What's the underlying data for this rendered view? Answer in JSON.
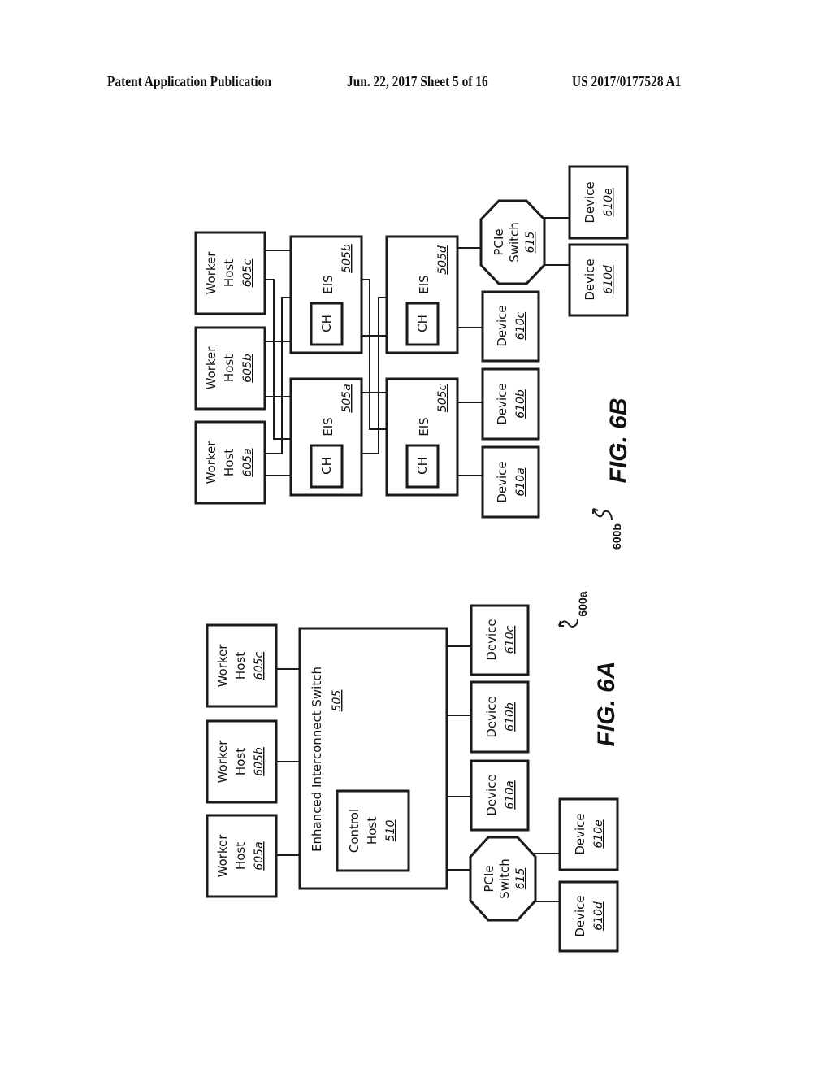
{
  "header": {
    "left": "Patent Application Publication",
    "center": "Jun. 22, 2017  Sheet 5 of 16",
    "right": "US 2017/0177528 A1"
  },
  "fig6b": {
    "caption": "FIG. 6B",
    "ref": "600b",
    "worker_hosts": [
      {
        "line1": "Worker",
        "line2": "Host",
        "ref": "605a"
      },
      {
        "line1": "Worker",
        "line2": "Host",
        "ref": "605b"
      },
      {
        "line1": "Worker",
        "line2": "Host",
        "ref": "605c"
      }
    ],
    "eis": [
      {
        "label": "EIS",
        "ref": "505a",
        "inner": "CH"
      },
      {
        "label": "EIS",
        "ref": "505b",
        "inner": "CH"
      },
      {
        "label": "EIS",
        "ref": "505c",
        "inner": "CH"
      },
      {
        "label": "EIS",
        "ref": "505d",
        "inner": "CH"
      }
    ],
    "devices": [
      {
        "label": "Device",
        "ref": "610a"
      },
      {
        "label": "Device",
        "ref": "610b"
      },
      {
        "label": "Device",
        "ref": "610c"
      },
      {
        "label": "Device",
        "ref": "610d"
      },
      {
        "label": "Device",
        "ref": "610e"
      }
    ],
    "pcie": {
      "line1": "PCIe",
      "line2": "Switch",
      "ref": "615"
    }
  },
  "fig6a": {
    "caption": "FIG. 6A",
    "ref": "600a",
    "worker_hosts": [
      {
        "line1": "Worker",
        "line2": "Host",
        "ref": "605a"
      },
      {
        "line1": "Worker",
        "line2": "Host",
        "ref": "605b"
      },
      {
        "line1": "Worker",
        "line2": "Host",
        "ref": "605c"
      }
    ],
    "switch": {
      "label": "Enhanced Interconnect Switch",
      "ref": "505"
    },
    "control_host": {
      "line1": "Control",
      "line2": "Host",
      "ref": "510"
    },
    "devices": [
      {
        "label": "Device",
        "ref": "610a"
      },
      {
        "label": "Device",
        "ref": "610b"
      },
      {
        "label": "Device",
        "ref": "610c"
      },
      {
        "label": "Device",
        "ref": "610d"
      },
      {
        "label": "Device",
        "ref": "610e"
      }
    ],
    "pcie": {
      "line1": "PCIe",
      "line2": "Switch",
      "ref": "615"
    }
  }
}
